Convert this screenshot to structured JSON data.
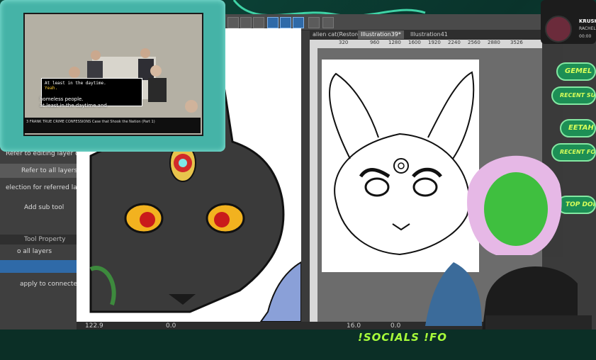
{
  "video": {
    "subtitle_box_line1": "At least in the daytime.",
    "subtitle_box_line2": "Yeah.",
    "caption_line1": "homeless people.",
    "caption_line2": "at least in the daytime and",
    "title_bar": "3 FRANK TRUE CRIME CONFESSIONS Case that Shook the Nation (Part 1)"
  },
  "left_panel": {
    "item1": "Refer to editing layer on",
    "item2": "Refer to all layers",
    "item3": "election for referred lay",
    "item4": "Add sub tool",
    "tool_property_label": "Tool Property",
    "item5": "o all layers",
    "item6": "apply to connected pixe"
  },
  "canvas1": {
    "zoom": "122.9",
    "rotation": "0.0"
  },
  "canvas2": {
    "tabs": [
      "alien cat(Restore",
      "Illustration39*",
      "Illustration41"
    ],
    "ruler": [
      "320",
      "960",
      "1280",
      "1600",
      "1920",
      "2240",
      "2560",
      "2880",
      "3526"
    ],
    "zoom": "16.0",
    "rotation": "0.0"
  },
  "overlay": {
    "music_title": "KRUSH",
    "music_artist": "RACHEL",
    "music_time": "00:00",
    "badges": [
      "GEMEL L",
      "RECENT SUBS",
      "EETAH",
      "RECENT FO",
      "TOP DON"
    ],
    "socials": "!SOCIALS !FO"
  },
  "colors": {
    "accent_green": "#a8ff3a",
    "frame_teal": "#45b3a7",
    "badge_green": "#1d8f55"
  }
}
